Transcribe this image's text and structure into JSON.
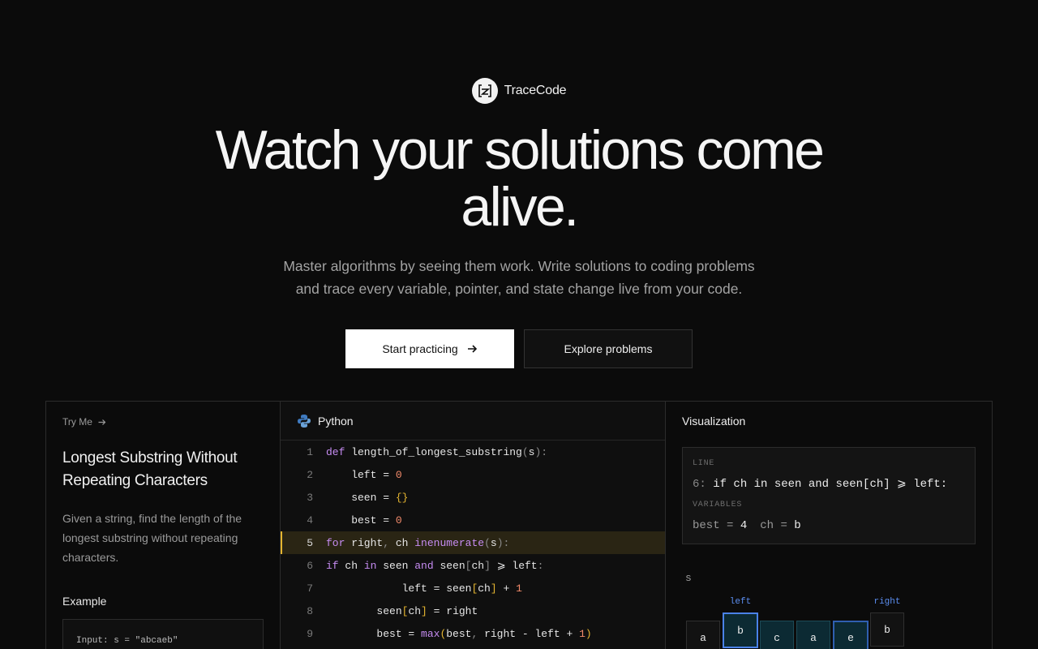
{
  "brand": {
    "name": "TraceCode",
    "logo_icon": "trace-logo-icon"
  },
  "hero": {
    "title_line1": "Watch your solutions come",
    "title_line2": "alive.",
    "subtitle_line1": "Master algorithms by seeing them work. Write solutions to coding problems",
    "subtitle_line2": "and trace every variable, pointer, and state change live from your code."
  },
  "cta": {
    "primary": "Start practicing",
    "primary_icon": "arrow-right-icon",
    "secondary": "Explore problems"
  },
  "problem": {
    "try_me": "Try Me",
    "title": "Longest Substring Without Repeating Characters",
    "description": "Given a string, find the length of the longest substring without repeating characters.",
    "example_label": "Example",
    "example_input": "Input: s = \"abcaeb\""
  },
  "editor": {
    "language": "Python",
    "language_icon": "python-icon",
    "active_line": 5,
    "line_numbers": [
      "1",
      "2",
      "3",
      "4",
      "5",
      "6",
      "7",
      "8",
      "9"
    ]
  },
  "visualization": {
    "title": "Visualization",
    "line_label": "LINE",
    "line_number": "6",
    "line_code": "if ch in seen and seen[ch] ⩾ left:",
    "variables_label": "VARIABLES",
    "vars": [
      {
        "name": "best",
        "value": "4"
      },
      {
        "name": "ch",
        "value": "b"
      }
    ],
    "array_name": "s",
    "cells": [
      "a",
      "b",
      "c",
      "a",
      "e",
      "b"
    ],
    "pointer_left": "left",
    "pointer_right": "right",
    "left_index": 1,
    "right_index": 5,
    "colors": {
      "accent_active": "#e5b530",
      "pointer": "#5b8ef0",
      "window": "#0c2a33"
    }
  }
}
